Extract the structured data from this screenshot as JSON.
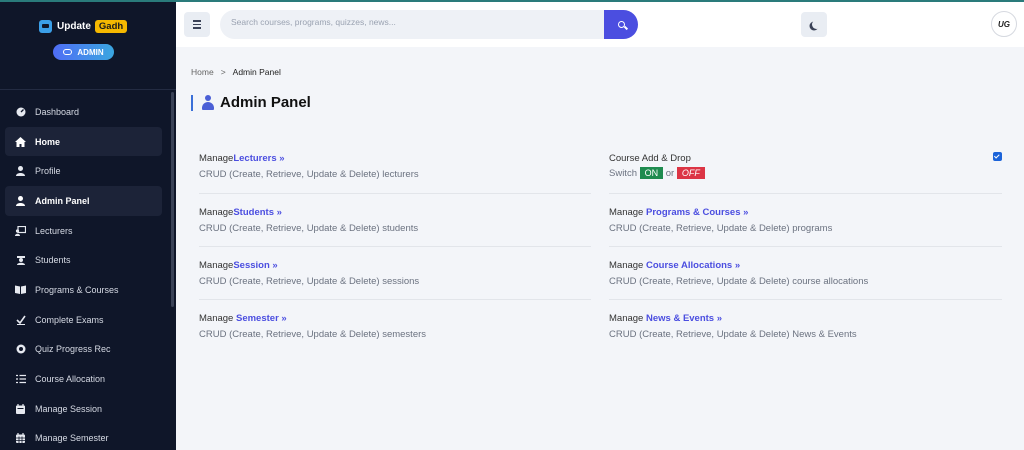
{
  "brand": {
    "name": "Update",
    "badge": "Gadh",
    "role": "ADMIN"
  },
  "sidebar": {
    "items": [
      {
        "label": "Dashboard",
        "icon": "dashboard-icon"
      },
      {
        "label": "Home",
        "icon": "home-icon"
      },
      {
        "label": "Profile",
        "icon": "user-icon"
      },
      {
        "label": "Admin Panel",
        "icon": "admin-icon",
        "active": true
      },
      {
        "label": "Lecturers",
        "icon": "lecturers-icon"
      },
      {
        "label": "Students",
        "icon": "students-icon"
      },
      {
        "label": "Programs & Courses",
        "icon": "book-icon"
      },
      {
        "label": "Complete Exams",
        "icon": "check-icon"
      },
      {
        "label": "Quiz Progress Rec",
        "icon": "progress-icon"
      },
      {
        "label": "Course Allocation",
        "icon": "list-icon"
      },
      {
        "label": "Manage Session",
        "icon": "calendar-icon"
      },
      {
        "label": "Manage Semester",
        "icon": "calendar-grid-icon"
      }
    ]
  },
  "topbar": {
    "search_placeholder": "Search courses, programs, quizzes, news...",
    "avatar_initials": "UG"
  },
  "breadcrumb": {
    "home": "Home",
    "separator": ">",
    "current": "Admin Panel"
  },
  "page": {
    "title": "Admin Panel"
  },
  "cards": [
    {
      "prefix": "Manage",
      "link": "Lecturers »",
      "desc": "CRUD (Create, Retrieve, Update & Delete) lecturers"
    },
    {
      "prefix": "Manage",
      "link": "Students »",
      "desc": "CRUD (Create, Retrieve, Update & Delete) students"
    },
    {
      "prefix": "Manage",
      "link": "Session »",
      "desc": "CRUD (Create, Retrieve, Update & Delete) sessions"
    },
    {
      "prefix": "Manage ",
      "link": "Semester »",
      "desc": "CRUD (Create, Retrieve, Update & Delete) semesters"
    },
    {
      "prefix": "Manage ",
      "link": "Programs & Courses »",
      "desc": "CRUD (Create, Retrieve, Update & Delete) programs"
    },
    {
      "prefix": "Manage ",
      "link": "Course Allocations »",
      "desc": "CRUD (Create, Retrieve, Update & Delete) course allocations"
    },
    {
      "prefix": "Manage ",
      "link": "News & Events »",
      "desc": "CRUD (Create, Retrieve, Update & Delete) News & Events"
    }
  ],
  "course_add_drop": {
    "title": "Course Add & Drop",
    "switch_label": "Switch",
    "on": "ON",
    "or": "or",
    "off": "OFF",
    "checked": true
  },
  "colors": {
    "accent": "#4b4ee0",
    "sidebar_bg": "#0f1629",
    "on": "#1e8b4f",
    "off": "#dc3545"
  }
}
